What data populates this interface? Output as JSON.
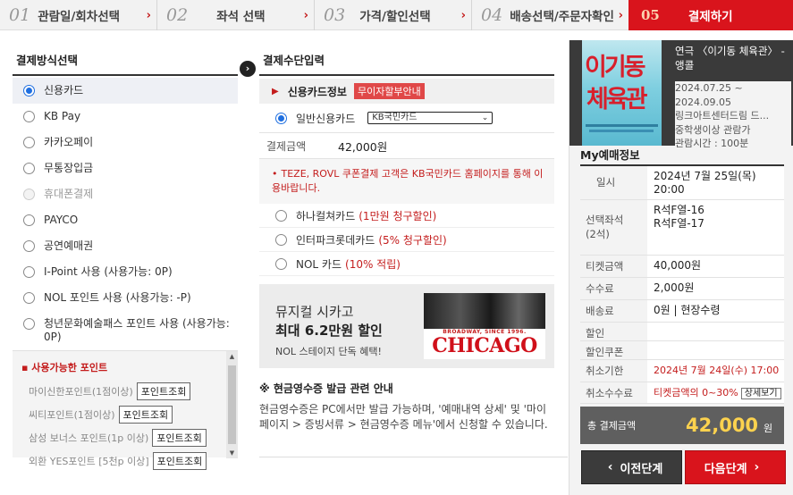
{
  "steps": [
    {
      "num": "01",
      "label": "관람일/회차선택"
    },
    {
      "num": "02",
      "label": "좌석 선택"
    },
    {
      "num": "03",
      "label": "가격/할인선택"
    },
    {
      "num": "04",
      "label": "배송선택/주문자확인"
    },
    {
      "num": "05",
      "label": "결제하기"
    }
  ],
  "step_arrow": "›",
  "left": {
    "title": "결제방식선택",
    "methods": [
      {
        "label": "신용카드",
        "state": "selected"
      },
      {
        "label": "KB Pay",
        "state": "normal"
      },
      {
        "label": "카카오페이",
        "state": "normal"
      },
      {
        "label": "무통장입금",
        "state": "normal"
      },
      {
        "label": "휴대폰결제",
        "state": "disabled"
      },
      {
        "label": "PAYCO",
        "state": "normal"
      },
      {
        "label": "공연예매권",
        "state": "normal"
      },
      {
        "label": "I-Point 사용 (사용가능: 0P)",
        "state": "normal"
      },
      {
        "label": "NOL 포인트 사용 (사용가능: -P)",
        "state": "normal"
      },
      {
        "label": "청년문화예술패스 포인트 사용 (사용가능: 0P)",
        "state": "normal"
      }
    ],
    "points_head": "사용가능한 포인트",
    "points": [
      {
        "label": "마이신한포인트(1점이상)",
        "btn": "포인트조회"
      },
      {
        "label": "씨티포인트(1점이상)",
        "btn": "포인트조회"
      },
      {
        "label": "삼성 보너스 포인트(1p 이상)",
        "btn": "포인트조회"
      },
      {
        "label": "외환 YES포인트 [5천p 이상]",
        "btn": "포인트조회"
      }
    ]
  },
  "mid": {
    "title": "결제수단입력",
    "cc_head": "신용카드정보",
    "badge": "무이자할부안내",
    "general_card": "일반신용카드",
    "card_select": "KB국민카드",
    "amount_label": "결제금액",
    "amount": "42,000원",
    "notice": "TEZE, ROVL 쿠폰결제 고객은 KB국민카드 홈페이지를 통해 이용바랍니다.",
    "options": [
      {
        "label": "하나컬쳐카드",
        "extra": "(1만원 청구할인)"
      },
      {
        "label": "인터파크롯데카드",
        "extra": "(5% 청구할인)"
      },
      {
        "label": "NOL 카드",
        "extra": "(10% 적립)"
      }
    ],
    "banner": {
      "line1": "뮤지컬 시카고",
      "line2": "최대 6.2만원 할인",
      "line3": "NOL 스테이지 단독 혜택!",
      "poster_tag": "BROADWAY, SINCE 1996.",
      "poster_title": "CHICAGO"
    },
    "cash_title": "※ 현금영수증 발급 관련 안내",
    "cash_body": "현금영수증은 PC에서만 발급 가능하며, '예매내역 상세' 및 '마이페이지 > 증빙서류 > 현금영수증 메뉴'에서 신청할 수 있습니다."
  },
  "right": {
    "poster_text1": "이기동",
    "poster_text2": "체육관",
    "show_title": "연극 〈이기동 체육관〉 - 앵콜",
    "show_dates": [
      "2024.07.25 ~",
      "2024.09.05"
    ],
    "venue": "링크아트센터드림 드...",
    "age": "중학생이상 관람가",
    "runtime": "관람시간 : 100분",
    "my_head": "My예매정보",
    "rows": [
      {
        "k": "일시",
        "v": "2024년 7월 25일(목) 20:00"
      },
      {
        "k": "선택좌석\n(2석)",
        "v": "R석F열-16\nR석F열-17"
      },
      {
        "k": "티켓금액",
        "v": "40,000원"
      },
      {
        "k": "수수료",
        "v": "2,000원"
      },
      {
        "k": "배송료",
        "v": "0원 | 현장수령"
      },
      {
        "k": "할인",
        "v": ""
      },
      {
        "k": "할인쿠폰",
        "v": ""
      },
      {
        "k": "취소기한",
        "v": "2024년 7월 24일(수) 17:00"
      },
      {
        "k": "취소수수료",
        "v": "티켓금액의 0~30%",
        "btn": "상세보기"
      }
    ],
    "total_label": "총 결제금액",
    "total_value": "42,000",
    "total_unit": "원"
  },
  "buttons": {
    "prev": "이전단계",
    "next": "다음단계",
    "prev_arrow": "‹",
    "next_arrow": "›"
  },
  "colors": {
    "accent": "#d9141c",
    "total_value": "#fcd24e"
  }
}
